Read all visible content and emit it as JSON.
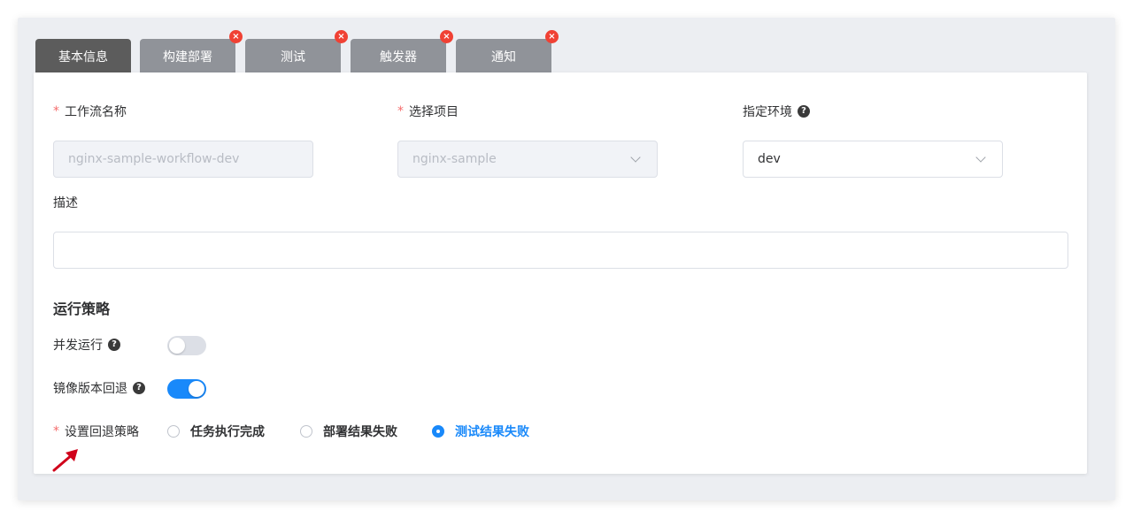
{
  "tabs": [
    {
      "label": "基本信息",
      "active": true,
      "closable": false
    },
    {
      "label": "构建部署",
      "active": false,
      "closable": true
    },
    {
      "label": "测试",
      "active": false,
      "closable": true
    },
    {
      "label": "触发器",
      "active": false,
      "closable": true
    },
    {
      "label": "通知",
      "active": false,
      "closable": true
    }
  ],
  "close_glyph": "×",
  "required_mark": "*",
  "help_glyph": "?",
  "form": {
    "workflow_name": {
      "label": "工作流名称",
      "value": "nginx-sample-workflow-dev",
      "disabled": true
    },
    "project": {
      "label": "选择项目",
      "value": "nginx-sample",
      "disabled": true
    },
    "environment": {
      "label": "指定环境",
      "value": "dev"
    },
    "description": {
      "label": "描述",
      "value": ""
    }
  },
  "strategy": {
    "title": "运行策略",
    "concurrent": {
      "label": "并发运行",
      "on": false
    },
    "rollback": {
      "label": "镜像版本回退",
      "on": true
    },
    "rollback_policy": {
      "label": "设置回退策略",
      "options": [
        {
          "label": "任务执行完成",
          "checked": false
        },
        {
          "label": "部署结果失败",
          "checked": false
        },
        {
          "label": "测试结果失败",
          "checked": true
        }
      ]
    }
  },
  "colors": {
    "accent": "#1989fa",
    "danger": "#f04134",
    "arrow": "#d0021b"
  },
  "icons": {
    "close": "close-icon",
    "help": "help-icon",
    "chevron": "chevron-down-icon",
    "arrow": "annotation-arrow-icon"
  }
}
